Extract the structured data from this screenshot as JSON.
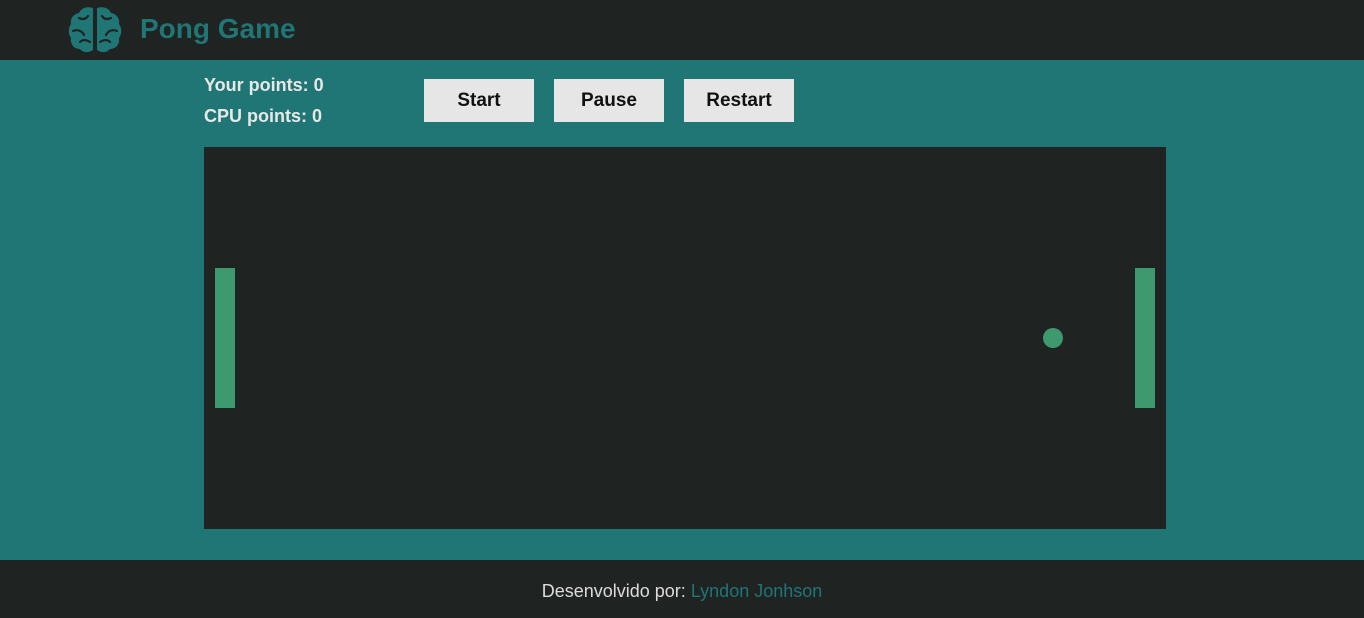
{
  "header": {
    "title": "Pong Game",
    "logo_icon": "brain-icon"
  },
  "scoreboard": {
    "player_label": "Your points: 0",
    "cpu_label": "CPU points: 0",
    "player_points": 0,
    "cpu_points": 0
  },
  "controls": {
    "start_label": "Start",
    "pause_label": "Pause",
    "restart_label": "Restart"
  },
  "court": {
    "left_paddle": "player-paddle",
    "right_paddle": "cpu-paddle",
    "ball": "ball"
  },
  "footer": {
    "prefix": "Desenvolvido por:",
    "author": "Lyndon Jonhson"
  },
  "colors": {
    "background": "#207575",
    "bars": "#1f2322",
    "accent": "#3e9a6e",
    "button": "#e6e6e6"
  }
}
